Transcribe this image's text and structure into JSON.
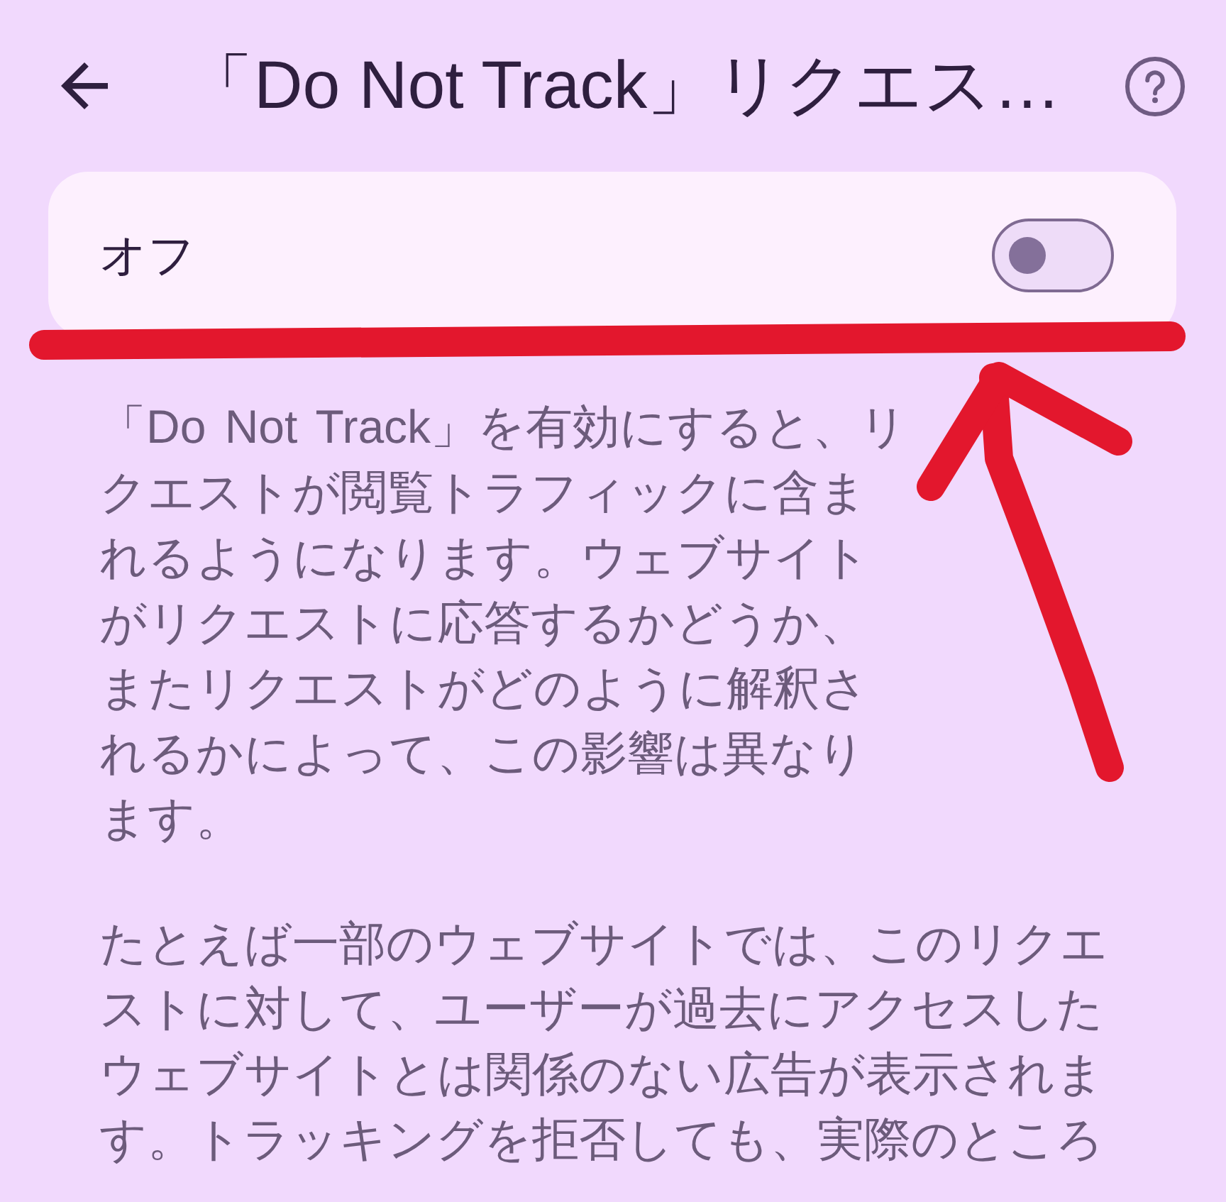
{
  "app_bar": {
    "title": "「Do Not Track」リクエス…"
  },
  "setting": {
    "label": "オフ",
    "on": false
  },
  "paragraphs": [
    "「Do Not Track」を有効にすると、リクエストが閲覧トラフィックに含まれるようになります。ウェブサイトがリクエストに応答するかどうか、またリクエストがどのように解釈されるかによって、この影響は異なります。",
    "たとえば一部のウェブサイトでは、このリクエストに対して、ユーザーが過去にアクセスしたウェブサイトとは関係のない広告が表示されます。トラッキングを拒否しても、実際のところ"
  ],
  "annotations": [
    {
      "kind": "underline"
    },
    {
      "kind": "arrow"
    }
  ]
}
